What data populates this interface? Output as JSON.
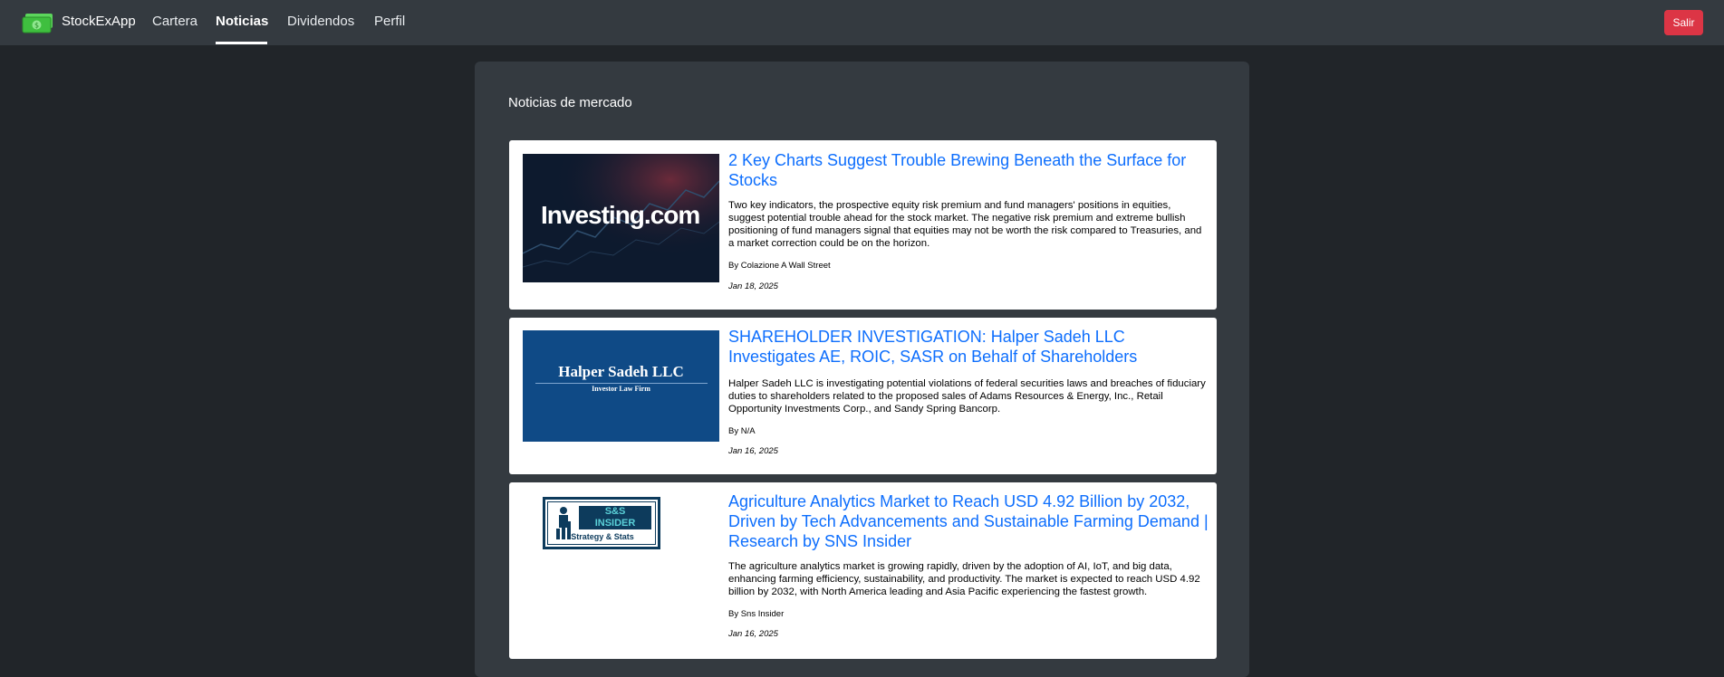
{
  "navbar": {
    "brand": "StockExApp",
    "links": [
      {
        "label": "Cartera",
        "active": false
      },
      {
        "label": "Noticias",
        "active": true
      },
      {
        "label": "Dividendos",
        "active": false
      },
      {
        "label": "Perfil",
        "active": false
      }
    ],
    "logout_label": "Salir",
    "brand_icon": "money-bill-icon"
  },
  "main": {
    "title": "Noticias de mercado"
  },
  "news": [
    {
      "title": "2 Key Charts Suggest Trouble Brewing Beneath the Surface for Stocks",
      "summary": "Two key indicators, the prospective equity risk premium and fund managers' positions in equities, suggest potential trouble ahead for the stock market. The negative risk premium and extreme bullish positioning of fund managers signal that equities may not be worth the risk compared to Treasuries, and a market correction could be on the horizon.",
      "author": "By Colazione A Wall Street",
      "date": "Jan 18, 2025",
      "image_logo": "Investing.com"
    },
    {
      "title": "SHAREHOLDER INVESTIGATION: Halper Sadeh LLC Investigates AE, ROIC, SASR on Behalf of Shareholders",
      "summary": "Halper Sadeh LLC is investigating potential violations of federal securities laws and breaches of fiduciary duties to shareholders related to the proposed sales of Adams Resources & Energy, Inc., Retail Opportunity Investments Corp., and Sandy Spring Bancorp.",
      "author": "By N/A",
      "date": "Jan 16, 2025",
      "image_logo": "Halper Sadeh LLC",
      "image_sub": "Investor Law Firm"
    },
    {
      "title": "Agriculture Analytics Market to Reach USD 4.92 Billion by 2032, Driven by Tech Advancements and Sustainable Farming Demand | Research by SNS Insider",
      "summary": "The agriculture analytics market is growing rapidly, driven by the adoption of AI, IoT, and big data, enhancing farming efficiency, sustainability, and productivity. The market is expected to reach USD 4.92 billion by 2032, with North America leading and Asia Pacific experiencing the fastest growth.",
      "author": "By Sns Insider",
      "date": "Jan 16, 2025",
      "image_logo": "S&S INSIDER",
      "image_sub": "Strategy & Stats"
    }
  ],
  "colors": {
    "background": "#212529",
    "navbar": "#343a40",
    "link": "#0d6efd",
    "logout": "#dc3545"
  }
}
